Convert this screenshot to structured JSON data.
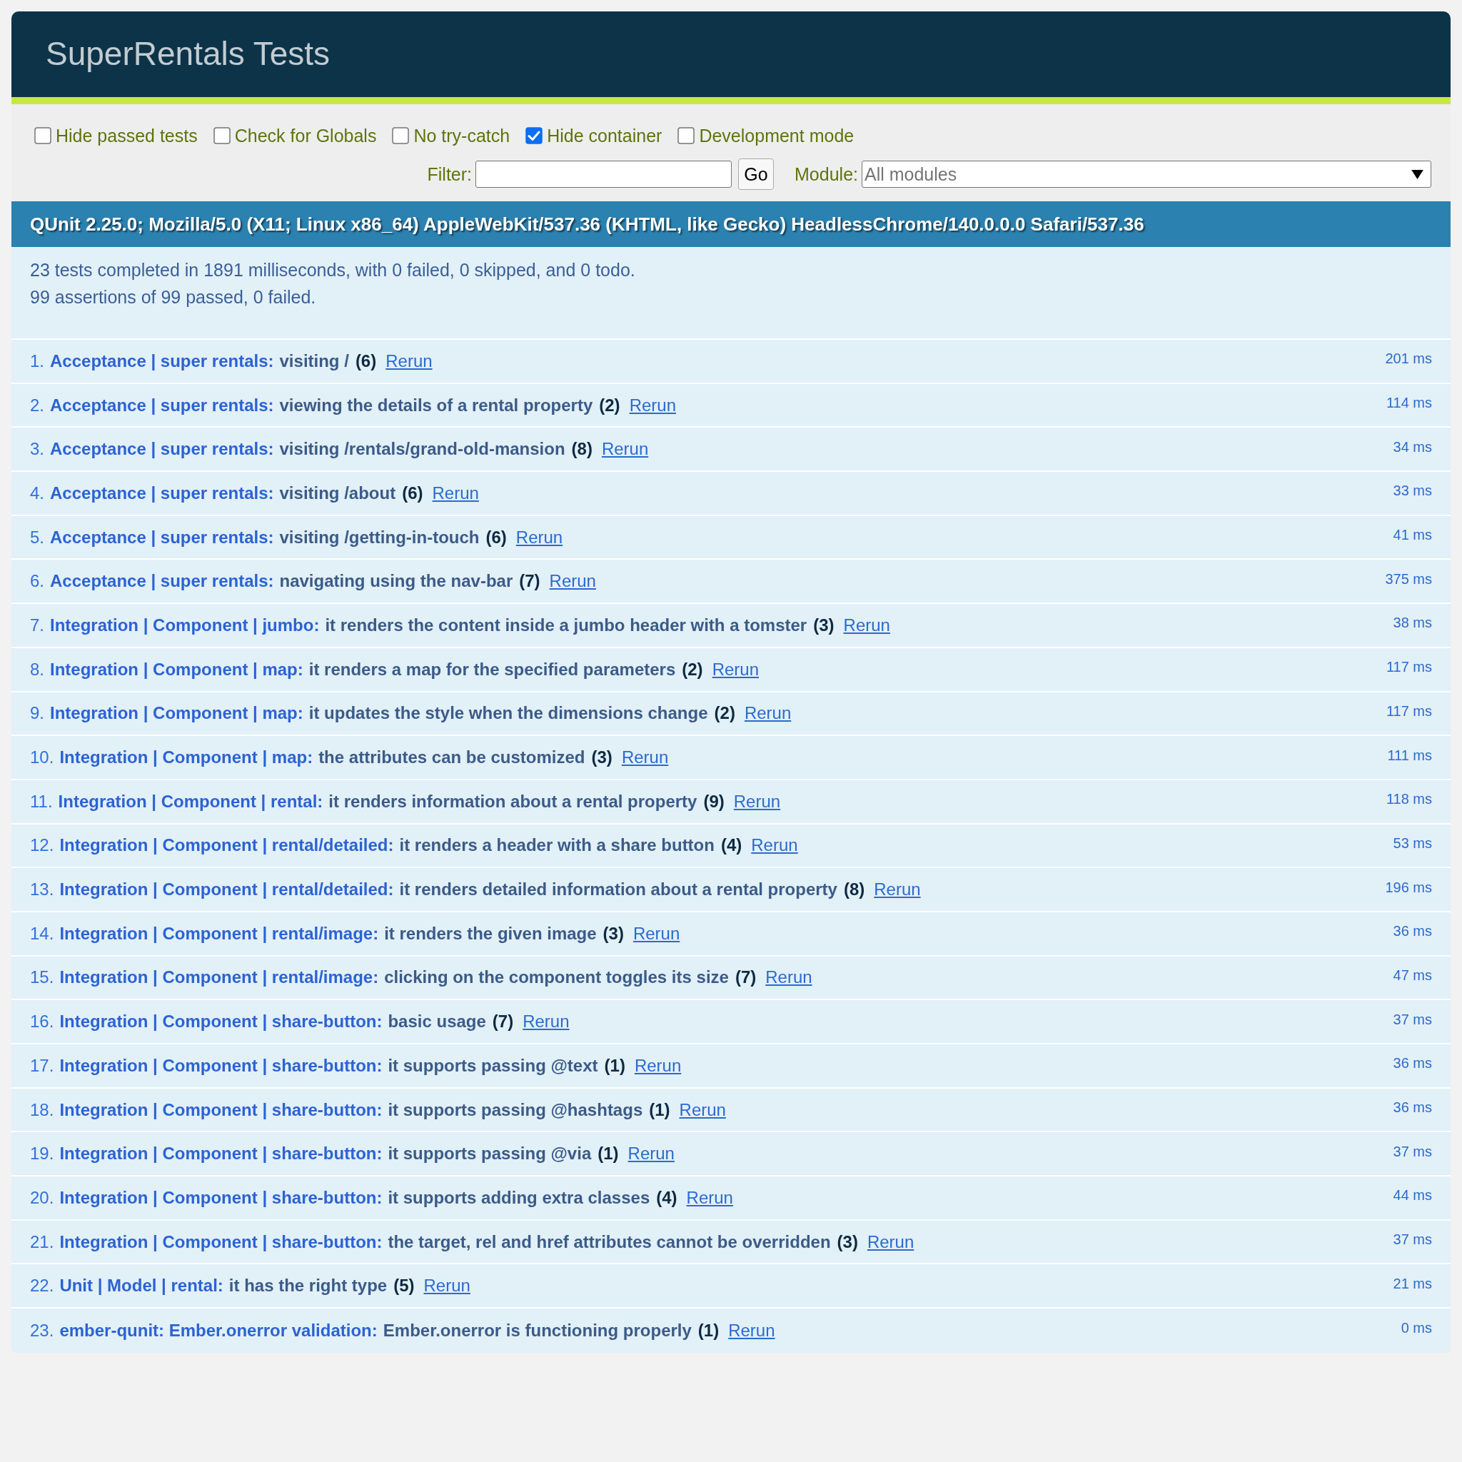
{
  "header": {
    "title": "SuperRentals Tests",
    "passed": true
  },
  "toolbar": {
    "options": [
      {
        "label": "Hide passed tests",
        "checked": false
      },
      {
        "label": "Check for Globals",
        "checked": false
      },
      {
        "label": "No try-catch",
        "checked": false
      },
      {
        "label": "Hide container",
        "checked": true
      },
      {
        "label": "Development mode",
        "checked": false
      }
    ],
    "filter": {
      "label": "Filter:",
      "button": "Go"
    },
    "module": {
      "label": "Module:",
      "placeholder": "All modules"
    }
  },
  "userbar": {
    "text": "QUnit 2.25.0; Mozilla/5.0 (X11; Linux x86_64) AppleWebKit/537.36 (KHTML, like Gecko) HeadlessChrome/140.0.0.0 Safari/537.36"
  },
  "summary": {
    "lines": [
      "23 tests completed in 1891 milliseconds, with 0 failed, 0 skipped, and 0 todo.",
      "99 assertions of 99 passed, 0 failed."
    ]
  },
  "tests": [
    {
      "number": "1.",
      "module": "Acceptance | super rentals:",
      "name": "visiting /",
      "count": "(6)",
      "rerun": "Rerun",
      "runtime": "201 ms"
    },
    {
      "number": "2.",
      "module": "Acceptance | super rentals:",
      "name": "viewing the details of a rental property",
      "count": "(2)",
      "rerun": "Rerun",
      "runtime": "114 ms"
    },
    {
      "number": "3.",
      "module": "Acceptance | super rentals:",
      "name": "visiting /rentals/grand-old-mansion",
      "count": "(8)",
      "rerun": "Rerun",
      "runtime": "34 ms"
    },
    {
      "number": "4.",
      "module": "Acceptance | super rentals:",
      "name": "visiting /about",
      "count": "(6)",
      "rerun": "Rerun",
      "runtime": "33 ms"
    },
    {
      "number": "5.",
      "module": "Acceptance | super rentals:",
      "name": "visiting /getting-in-touch",
      "count": "(6)",
      "rerun": "Rerun",
      "runtime": "41 ms"
    },
    {
      "number": "6.",
      "module": "Acceptance | super rentals:",
      "name": "navigating using the nav-bar",
      "count": "(7)",
      "rerun": "Rerun",
      "runtime": "375 ms"
    },
    {
      "number": "7.",
      "module": "Integration | Component | jumbo:",
      "name": "it renders the content inside a jumbo header with a tomster",
      "count": "(3)",
      "rerun": "Rerun",
      "runtime": "38 ms"
    },
    {
      "number": "8.",
      "module": "Integration | Component | map:",
      "name": "it renders a map for the specified parameters",
      "count": "(2)",
      "rerun": "Rerun",
      "runtime": "117 ms"
    },
    {
      "number": "9.",
      "module": "Integration | Component | map:",
      "name": "it updates the style when the dimensions change",
      "count": "(2)",
      "rerun": "Rerun",
      "runtime": "117 ms"
    },
    {
      "number": "10.",
      "module": "Integration | Component | map:",
      "name": "the attributes can be customized",
      "count": "(3)",
      "rerun": "Rerun",
      "runtime": "111 ms"
    },
    {
      "number": "11.",
      "module": "Integration | Component | rental:",
      "name": "it renders information about a rental property",
      "count": "(9)",
      "rerun": "Rerun",
      "runtime": "118 ms"
    },
    {
      "number": "12.",
      "module": "Integration | Component | rental/detailed:",
      "name": "it renders a header with a share button",
      "count": "(4)",
      "rerun": "Rerun",
      "runtime": "53 ms"
    },
    {
      "number": "13.",
      "module": "Integration | Component | rental/detailed:",
      "name": "it renders detailed information about a rental property",
      "count": "(8)",
      "rerun": "Rerun",
      "runtime": "196 ms"
    },
    {
      "number": "14.",
      "module": "Integration | Component | rental/image:",
      "name": "it renders the given image",
      "count": "(3)",
      "rerun": "Rerun",
      "runtime": "36 ms"
    },
    {
      "number": "15.",
      "module": "Integration | Component | rental/image:",
      "name": "clicking on the component toggles its size",
      "count": "(7)",
      "rerun": "Rerun",
      "runtime": "47 ms"
    },
    {
      "number": "16.",
      "module": "Integration | Component | share-button:",
      "name": "basic usage",
      "count": "(7)",
      "rerun": "Rerun",
      "runtime": "37 ms"
    },
    {
      "number": "17.",
      "module": "Integration | Component | share-button:",
      "name": "it supports passing @text",
      "count": "(1)",
      "rerun": "Rerun",
      "runtime": "36 ms"
    },
    {
      "number": "18.",
      "module": "Integration | Component | share-button:",
      "name": "it supports passing @hashtags",
      "count": "(1)",
      "rerun": "Rerun",
      "runtime": "36 ms"
    },
    {
      "number": "19.",
      "module": "Integration | Component | share-button:",
      "name": "it supports passing @via",
      "count": "(1)",
      "rerun": "Rerun",
      "runtime": "37 ms"
    },
    {
      "number": "20.",
      "module": "Integration | Component | share-button:",
      "name": "it supports adding extra classes",
      "count": "(4)",
      "rerun": "Rerun",
      "runtime": "44 ms"
    },
    {
      "number": "21.",
      "module": "Integration | Component | share-button:",
      "name": "the target, rel and href attributes cannot be overridden",
      "count": "(3)",
      "rerun": "Rerun",
      "runtime": "37 ms"
    },
    {
      "number": "22.",
      "module": "Unit | Model | rental:",
      "name": "it has the right type",
      "count": "(5)",
      "rerun": "Rerun",
      "runtime": "21 ms"
    },
    {
      "number": "23.",
      "module": "ember-qunit: Ember.onerror validation:",
      "name": "Ember.onerror is functioning properly",
      "count": "(1)",
      "rerun": "Rerun",
      "runtime": "0 ms"
    }
  ]
}
